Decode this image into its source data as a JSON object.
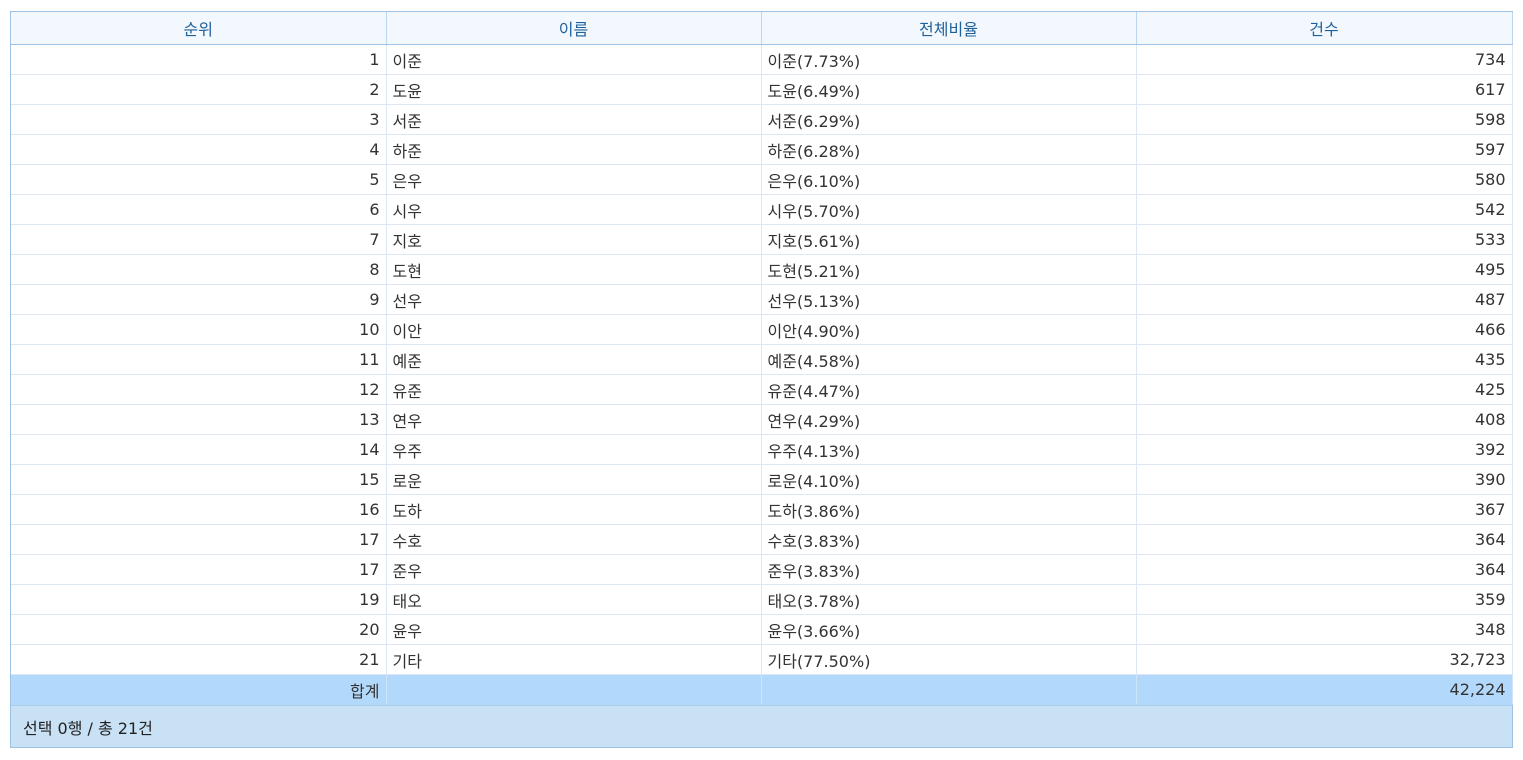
{
  "headers": [
    "순위",
    "이름",
    "전체비율",
    "건수"
  ],
  "rows": [
    {
      "rank": "1",
      "name": "이준",
      "ratio": "이준(7.73%)",
      "count": "734"
    },
    {
      "rank": "2",
      "name": "도윤",
      "ratio": "도윤(6.49%)",
      "count": "617"
    },
    {
      "rank": "3",
      "name": "서준",
      "ratio": "서준(6.29%)",
      "count": "598"
    },
    {
      "rank": "4",
      "name": "하준",
      "ratio": "하준(6.28%)",
      "count": "597"
    },
    {
      "rank": "5",
      "name": "은우",
      "ratio": "은우(6.10%)",
      "count": "580"
    },
    {
      "rank": "6",
      "name": "시우",
      "ratio": "시우(5.70%)",
      "count": "542"
    },
    {
      "rank": "7",
      "name": "지호",
      "ratio": "지호(5.61%)",
      "count": "533"
    },
    {
      "rank": "8",
      "name": "도현",
      "ratio": "도현(5.21%)",
      "count": "495"
    },
    {
      "rank": "9",
      "name": "선우",
      "ratio": "선우(5.13%)",
      "count": "487"
    },
    {
      "rank": "10",
      "name": "이안",
      "ratio": "이안(4.90%)",
      "count": "466"
    },
    {
      "rank": "11",
      "name": "예준",
      "ratio": "예준(4.58%)",
      "count": "435"
    },
    {
      "rank": "12",
      "name": "유준",
      "ratio": "유준(4.47%)",
      "count": "425"
    },
    {
      "rank": "13",
      "name": "연우",
      "ratio": "연우(4.29%)",
      "count": "408"
    },
    {
      "rank": "14",
      "name": "우주",
      "ratio": "우주(4.13%)",
      "count": "392"
    },
    {
      "rank": "15",
      "name": "로운",
      "ratio": "로운(4.10%)",
      "count": "390"
    },
    {
      "rank": "16",
      "name": "도하",
      "ratio": "도하(3.86%)",
      "count": "367"
    },
    {
      "rank": "17",
      "name": "수호",
      "ratio": "수호(3.83%)",
      "count": "364"
    },
    {
      "rank": "17",
      "name": "준우",
      "ratio": "준우(3.83%)",
      "count": "364"
    },
    {
      "rank": "19",
      "name": "태오",
      "ratio": "태오(3.78%)",
      "count": "359"
    },
    {
      "rank": "20",
      "name": "윤우",
      "ratio": "윤우(3.66%)",
      "count": "348"
    },
    {
      "rank": "21",
      "name": "기타",
      "ratio": "기타(77.50%)",
      "count": "32,723"
    }
  ],
  "summary": {
    "label": "합계",
    "name": "",
    "ratio": "",
    "count": "42,224"
  },
  "footer": {
    "status": "선택 0행 / 총 21건"
  },
  "colors": {
    "header_bg": "#f2f8fd",
    "header_text": "#1f5f9a",
    "summary_bg": "#b2d9fb",
    "footer_bg": "#c8e1f5",
    "border": "#9cc3e5"
  }
}
